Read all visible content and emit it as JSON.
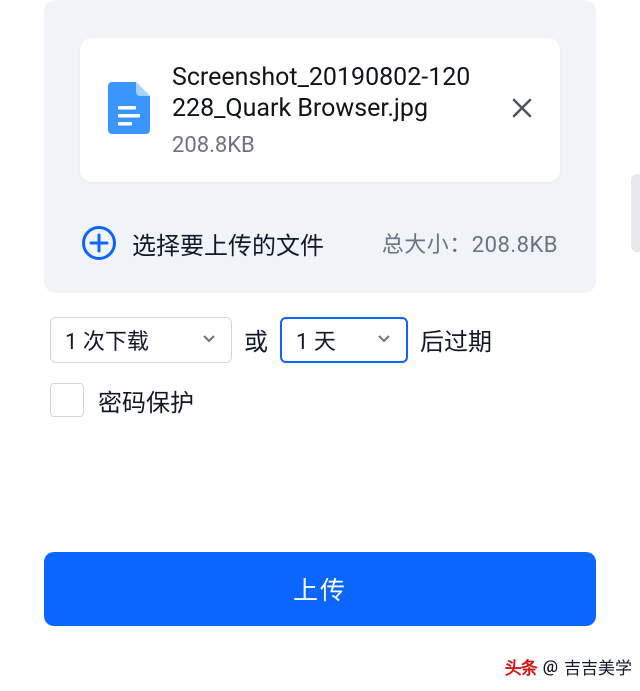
{
  "file": {
    "name": "Screenshot_20190802-120228_Quark Browser.jpg",
    "size": "208.8KB"
  },
  "add": {
    "label": "选择要上传的文件",
    "total_prefix": "总大小：",
    "total_value": "208.8KB"
  },
  "expiry": {
    "downloads_value": "1 次下载",
    "separator": "或",
    "days_value": "1 天",
    "suffix": "后过期"
  },
  "password": {
    "label": "密码保护"
  },
  "actions": {
    "upload": "上传"
  },
  "watermark": {
    "brand": "头条",
    "at": "@",
    "user": "吉吉美学"
  }
}
